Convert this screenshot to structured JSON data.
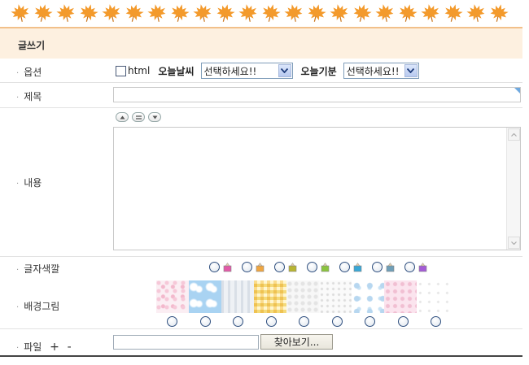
{
  "header": {
    "leaf_count": 22,
    "title": "글쓰기",
    "leaf_color": "#f39a2c"
  },
  "options": {
    "label": "옵션",
    "html_label": "html",
    "weather_label": "오늘날씨",
    "weather_select": "선택하세요!!",
    "mood_label": "오늘기분",
    "mood_select": "선택하세요!!"
  },
  "subject": {
    "label": "제목",
    "value": ""
  },
  "content": {
    "label": "내용",
    "value": ""
  },
  "font_color": {
    "label": "글자색깔",
    "colors": [
      "#e25aa8",
      "#f0a640",
      "#b8b530",
      "#8bc43e",
      "#39a7d6",
      "#6f9fb8",
      "#a45bd6"
    ]
  },
  "background": {
    "label": "배경그림",
    "tiles": [
      "pink-floral",
      "blue-sky",
      "grey-pattern",
      "yellow-check",
      "light-grey",
      "white-dots",
      "blue-flower",
      "pink-lace",
      "white-sparkle"
    ]
  },
  "file": {
    "label": "파일",
    "add": "+",
    "remove": "-",
    "browse_label": "찾아보기..."
  }
}
